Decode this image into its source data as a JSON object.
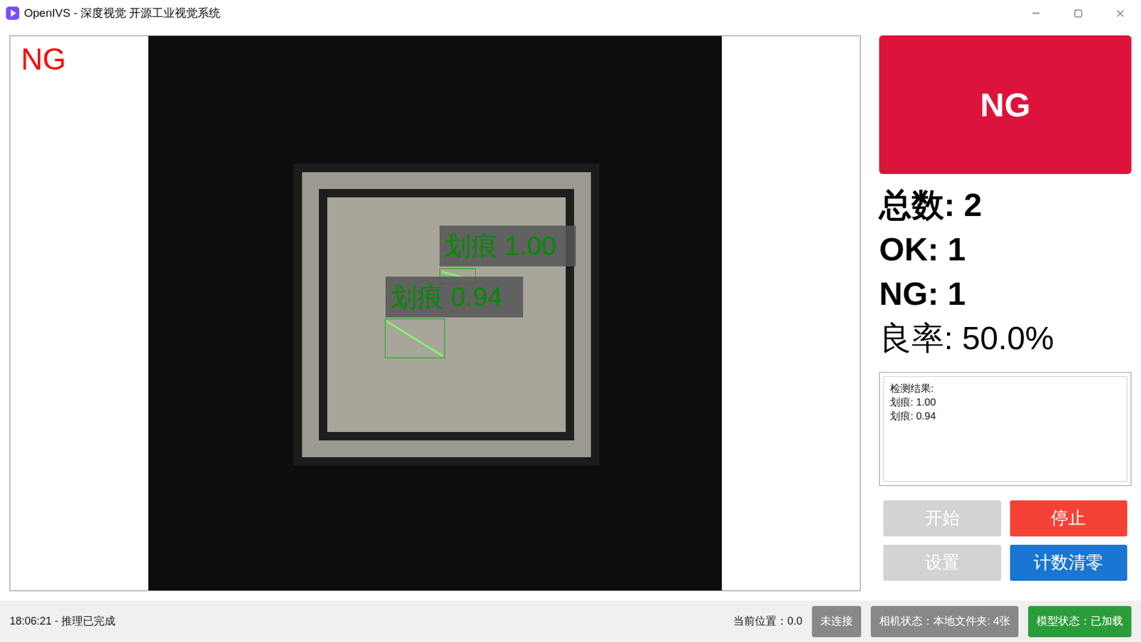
{
  "window": {
    "title": "OpenIVS - 深度视觉 开源工业视觉系统"
  },
  "image_view": {
    "verdict": "NG",
    "detections": [
      {
        "label": "划痕 1.00"
      },
      {
        "label": "划痕 0.94"
      }
    ]
  },
  "result": {
    "verdict": "NG"
  },
  "stats": [
    {
      "label": "总数: 2",
      "bold": true
    },
    {
      "label": "OK: 1",
      "bold": true
    },
    {
      "label": "NG: 1",
      "bold": true
    },
    {
      "label": "良率: 50.0%",
      "bold": false
    }
  ],
  "result_box": {
    "lines": [
      "检测结果:",
      "划痕: 1.00",
      "划痕: 0.94"
    ]
  },
  "buttons": [
    {
      "label": "开始",
      "disabled": true,
      "color": "#d3d3d3"
    },
    {
      "label": "停止",
      "disabled": false,
      "color": "#f44336"
    },
    {
      "label": "设置",
      "disabled": true,
      "color": "#d3d3d3"
    },
    {
      "label": "计数清零",
      "disabled": false,
      "color": "#1976d2"
    }
  ],
  "status_bar": {
    "message": "18:06:21 - 推理已完成",
    "position": "当前位置：0.0",
    "badges": [
      {
        "label": "未连接",
        "color": "#888888"
      },
      {
        "label": "相机状态：本地文件夹: 4张",
        "color": "#888888"
      },
      {
        "label": "模型状态：已加载",
        "color": "#2a9d3a"
      }
    ]
  }
}
